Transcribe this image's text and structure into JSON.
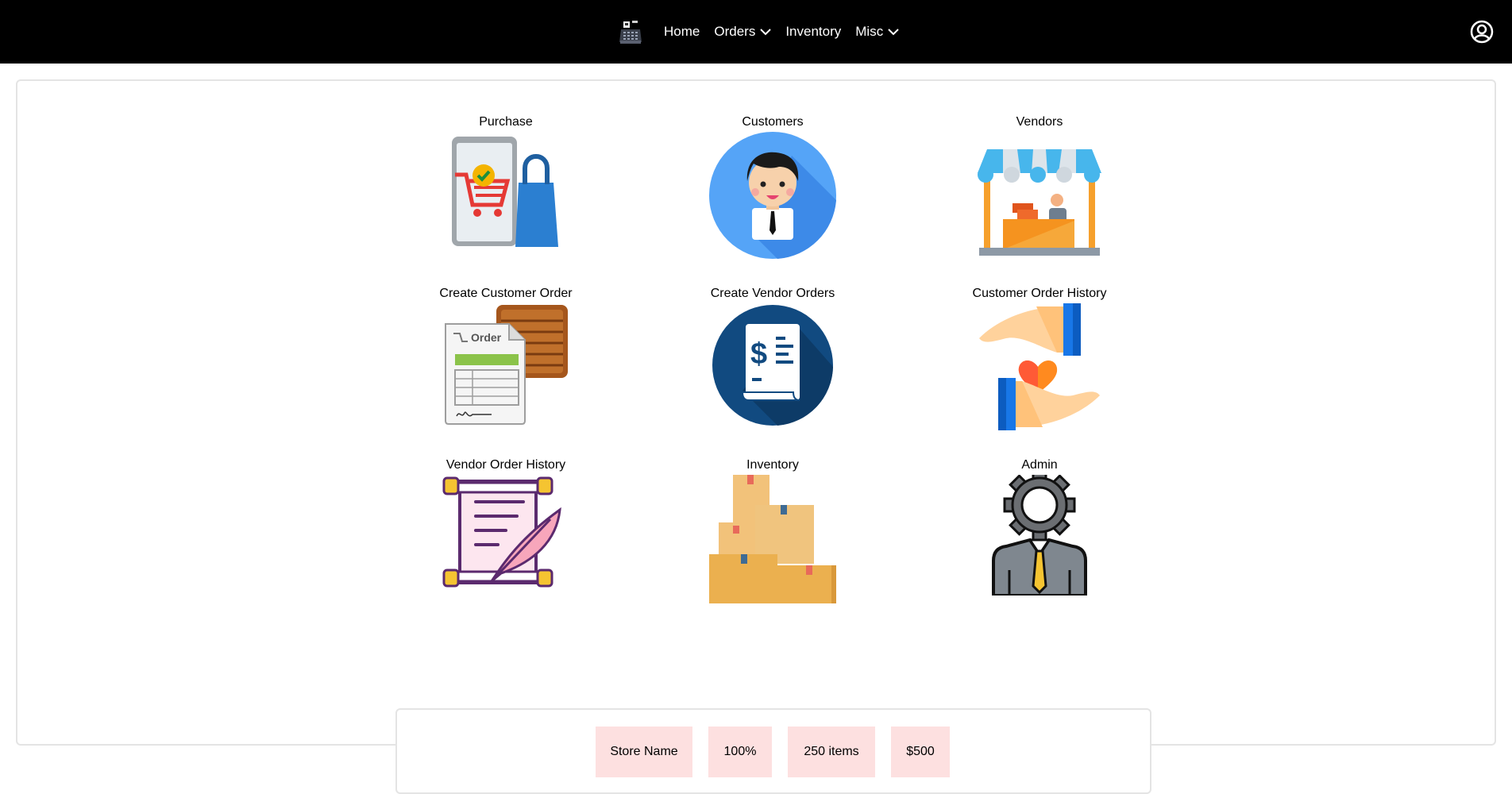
{
  "nav": {
    "logo_icon": "cash-register-icon",
    "items": [
      {
        "label": "Home",
        "dropdown": false
      },
      {
        "label": "Orders",
        "dropdown": true
      },
      {
        "label": "Inventory",
        "dropdown": false
      },
      {
        "label": "Misc",
        "dropdown": true
      }
    ],
    "profile_icon": "user-circle-icon"
  },
  "tiles": [
    {
      "label": "Purchase",
      "icon": "shopping-phone-bag-icon"
    },
    {
      "label": "Customers",
      "icon": "customer-avatar-icon"
    },
    {
      "label": "Vendors",
      "icon": "vendor-stall-icon"
    },
    {
      "label": "Create Customer Order",
      "icon": "order-form-crate-icon"
    },
    {
      "label": "Create Vendor Orders",
      "icon": "invoice-dollar-icon"
    },
    {
      "label": "Customer Order History",
      "icon": "hands-heart-icon"
    },
    {
      "label": "Vendor Order History",
      "icon": "scroll-quill-icon"
    },
    {
      "label": "Inventory",
      "icon": "boxes-icon"
    },
    {
      "label": "Admin",
      "icon": "admin-gear-person-icon"
    }
  ],
  "status": {
    "store_name": "Store Name",
    "percent": "100%",
    "items": "250 items",
    "amount": "$500"
  },
  "colors": {
    "navbar": "#000000",
    "stat_bg": "#fde0e0",
    "border": "#e4e4e4"
  }
}
